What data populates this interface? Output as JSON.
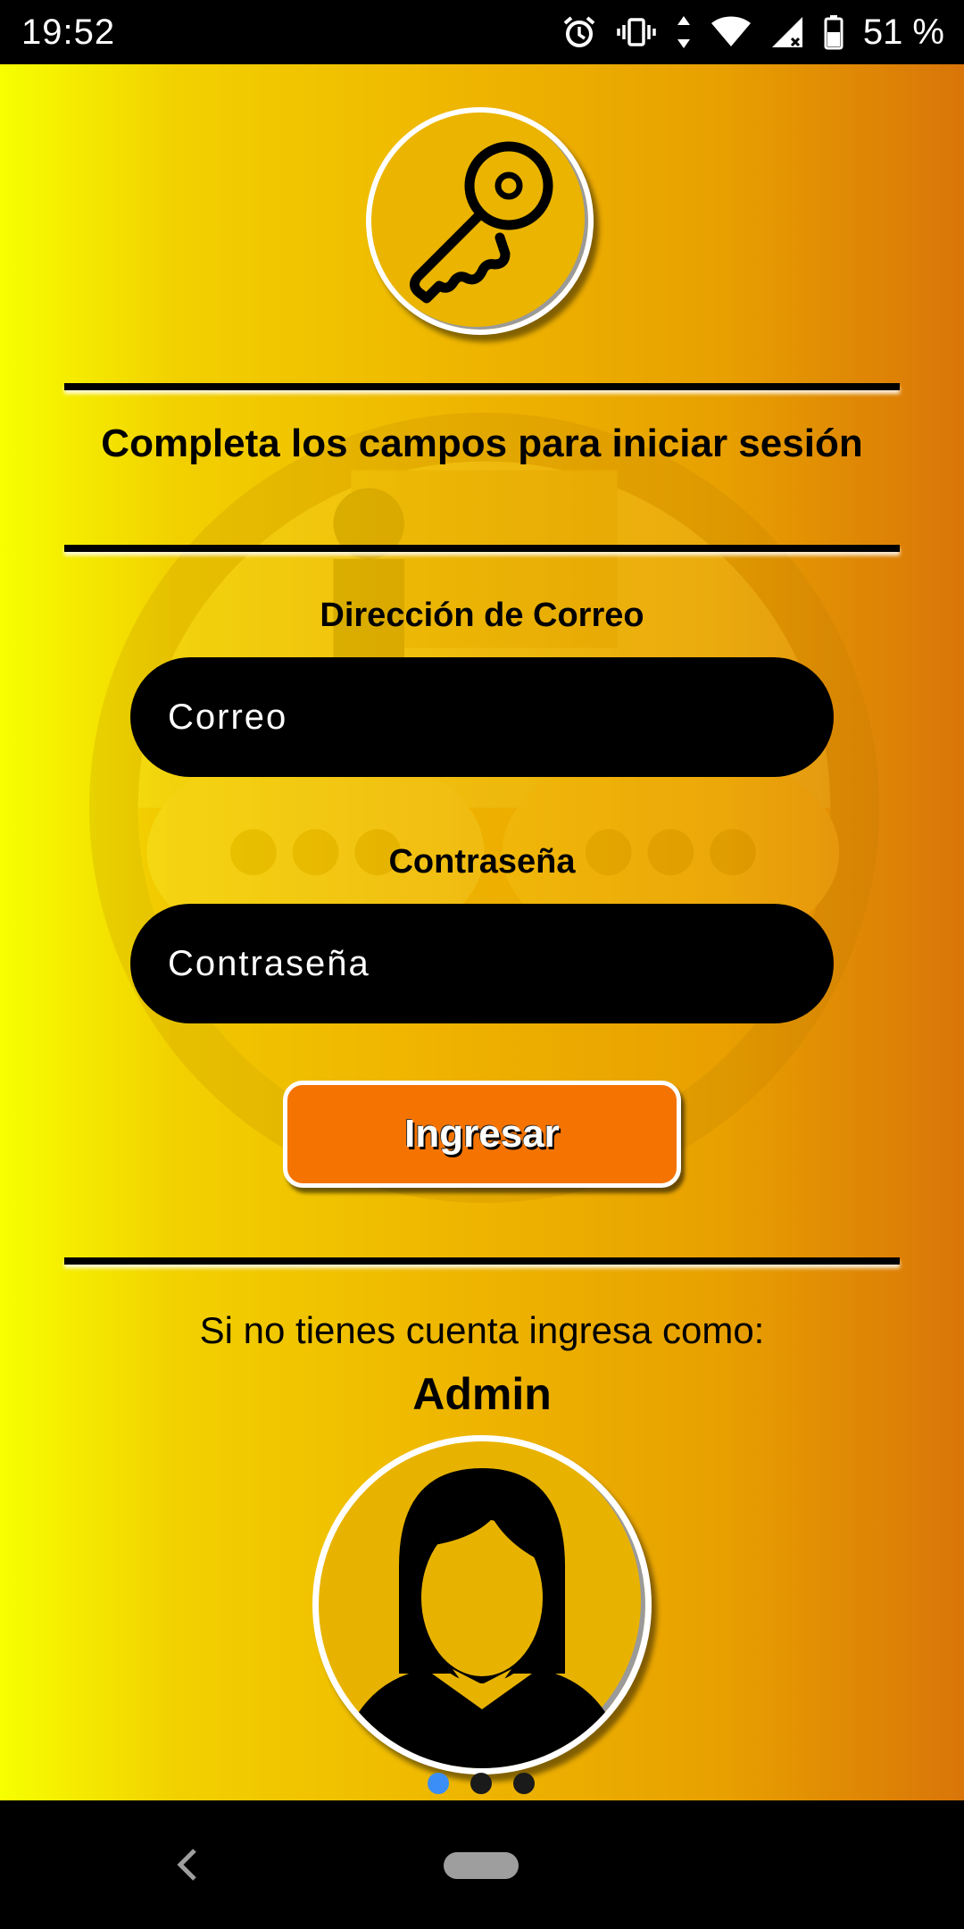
{
  "status_bar": {
    "time": "19:52",
    "icons": [
      "alarm-icon",
      "vibrate-icon",
      "data-arrows-icon",
      "wifi-icon",
      "signal-icon",
      "battery-icon"
    ],
    "battery_text": "51 %"
  },
  "header": {
    "logo_icon": "key-icon",
    "title": "Completa los campos para iniciar sesión"
  },
  "form": {
    "email_label": "Dirección de Correo",
    "email_placeholder": "Correo",
    "email_value": "",
    "password_label": "Contraseña",
    "password_placeholder": "Contraseña",
    "password_value": "",
    "submit_label": "Ingresar"
  },
  "guest": {
    "prompt": "Si no tienes cuenta ingresa como:",
    "role": "Admin",
    "avatar_icon": "female-user-icon",
    "pager": {
      "count": 3,
      "active_index": 0
    }
  },
  "colors": {
    "gradient_start": "#f7ff00",
    "gradient_end": "#d97509",
    "button": "#f57300",
    "field": "#000000",
    "pager_active": "#3b8ef5"
  },
  "nav_bar": {
    "icons": [
      "back-icon",
      "home-pill-icon"
    ]
  }
}
